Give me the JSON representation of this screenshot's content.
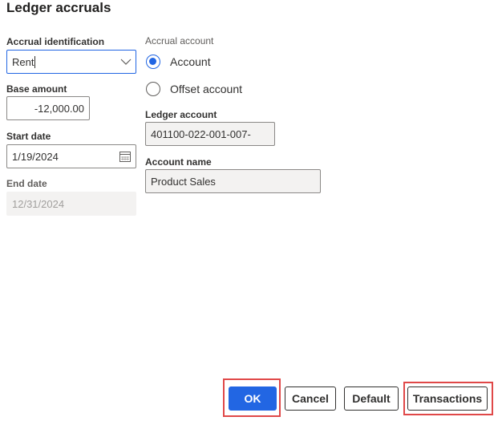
{
  "dialog": {
    "title": "Ledger accruals"
  },
  "form": {
    "accrual_identification": {
      "label": "Accrual identification",
      "value": "Rent"
    },
    "base_amount": {
      "label": "Base amount",
      "value": "-12,000.00"
    },
    "start_date": {
      "label": "Start date",
      "value": "1/19/2024"
    },
    "end_date": {
      "label": "End date",
      "value": "12/31/2024"
    },
    "accrual_account": {
      "label": "Accrual account",
      "options": [
        {
          "label": "Account",
          "selected": true
        },
        {
          "label": "Offset account",
          "selected": false
        }
      ]
    },
    "ledger_account": {
      "label": "Ledger account",
      "value": "401100-022-001-007-"
    },
    "account_name": {
      "label": "Account name",
      "value": "Product Sales"
    }
  },
  "buttons": {
    "ok": "OK",
    "cancel": "Cancel",
    "default": "Default",
    "transactions": "Transactions"
  },
  "colors": {
    "accent": "#2266e3",
    "highlight": "#e04848"
  },
  "icons": {
    "dropdown": "chevron-down-icon",
    "calendar": "calendar-icon"
  }
}
